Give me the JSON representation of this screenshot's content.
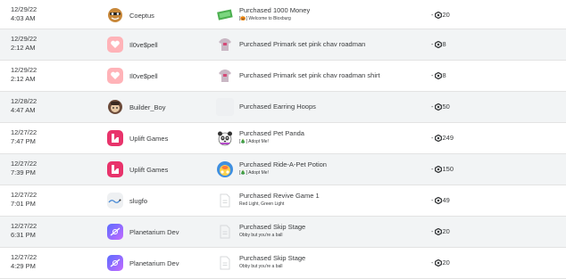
{
  "transactions": [
    {
      "date": "12/29/22",
      "time": "4:03 AM",
      "seller": "Coeptus",
      "seller_icon": "cookie-avatar-icon",
      "item_icon": "money-bill-icon",
      "title": "Purchased 1000 Money",
      "subtitle": "[🎃] Welcome to Bloxburg",
      "amount": "20"
    },
    {
      "date": "12/29/22",
      "time": "2:12 AM",
      "seller": "Il0ve$pell",
      "seller_icon": "heart-avatar-icon",
      "item_icon": "shirt-icon",
      "title": "Purchased Primark set pink chav roadman",
      "subtitle": "",
      "amount": "8"
    },
    {
      "date": "12/29/22",
      "time": "2:12 AM",
      "seller": "Il0ve$pell",
      "seller_icon": "heart-avatar-icon",
      "item_icon": "shirt-icon",
      "title": "Purchased Primark set pink chav roadman shirt",
      "subtitle": "",
      "amount": "8"
    },
    {
      "date": "12/28/22",
      "time": "4:47 AM",
      "seller": "Builder_Boy",
      "seller_icon": "avatar-head-icon",
      "item_icon": "placeholder-icon",
      "title": "Purchased Earring Hoops",
      "subtitle": "",
      "amount": "50"
    },
    {
      "date": "12/27/22",
      "time": "7:47 PM",
      "seller": "Uplift Games",
      "seller_icon": "uplift-logo-icon",
      "item_icon": "panda-icon",
      "title": "Purchased Pet Panda",
      "subtitle": "[🎄] Adopt Me!",
      "amount": "249"
    },
    {
      "date": "12/27/22",
      "time": "7:39 PM",
      "seller": "Uplift Games",
      "seller_icon": "uplift-logo-icon",
      "item_icon": "potion-icon",
      "title": "Purchased Ride-A-Pet Potion",
      "subtitle": "[🎄] Adopt Me!",
      "amount": "150"
    },
    {
      "date": "12/27/22",
      "time": "7:01 PM",
      "seller": "slugfo",
      "seller_icon": "slug-avatar-icon",
      "item_icon": "document-icon",
      "title": "Purchased Revive Game 1",
      "subtitle": "Red Light, Green Light",
      "amount": "49"
    },
    {
      "date": "12/27/22",
      "time": "6:31 PM",
      "seller": "Planetarium Dev",
      "seller_icon": "planet-logo-icon",
      "item_icon": "document-icon",
      "title": "Purchased Skip Stage",
      "subtitle": "Obby but you're a ball",
      "amount": "20"
    },
    {
      "date": "12/27/22",
      "time": "4:29 PM",
      "seller": "Planetarium Dev",
      "seller_icon": "planet-logo-icon",
      "item_icon": "document-icon",
      "title": "Purchased Skip Stage",
      "subtitle": "Obby but you're a ball",
      "amount": "20"
    }
  ],
  "amount_prefix": "-",
  "currency_icon": "robux-icon"
}
